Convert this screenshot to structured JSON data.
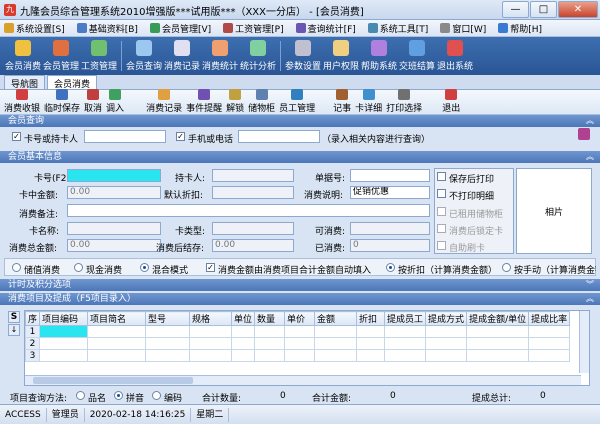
{
  "window": {
    "title": "九隆会员综合管理系统2010增强版***试用版***（XXX一分店） - [会员消费]",
    "min": "—",
    "max": "□",
    "close": "✕"
  },
  "menu": [
    {
      "label": "系统设置[S]",
      "color": "#d9a02b"
    },
    {
      "label": "基础资料[B]",
      "color": "#4b7bc4"
    },
    {
      "label": "会员管理[V]",
      "color": "#3a9a5a"
    },
    {
      "label": "工资管理[P]",
      "color": "#b04a4a"
    },
    {
      "label": "查询统计[F]",
      "color": "#6a58b0"
    },
    {
      "label": "系统工具[T]",
      "color": "#4a8ab0"
    },
    {
      "label": "窗口[W]",
      "color": "#8a8a8a"
    },
    {
      "label": "帮助[H]",
      "color": "#3a7ad0"
    }
  ],
  "toolbar": [
    {
      "label": "会员消费",
      "color": "#f0c040"
    },
    {
      "label": "会员管理",
      "color": "#e07040"
    },
    {
      "label": "工资管理",
      "color": "#70c070"
    },
    {
      "label": "会员查询",
      "color": "#9cc8f0"
    },
    {
      "label": "消费记录",
      "color": "#e0e0f0"
    },
    {
      "label": "消费统计",
      "color": "#f0a070"
    },
    {
      "label": "统计分析",
      "color": "#80d0a0"
    },
    {
      "label": "参数设置",
      "color": "#c0c0d0"
    },
    {
      "label": "用户权限",
      "color": "#f0d080"
    },
    {
      "label": "帮助系统",
      "color": "#b080e0"
    },
    {
      "label": "交班结算",
      "color": "#60a0e0"
    },
    {
      "label": "退出系统",
      "color": "#e05050"
    }
  ],
  "tabs": [
    "导航图",
    "会员消费"
  ],
  "subtoolbar": [
    {
      "label": "消费收银",
      "color": "#d04040"
    },
    {
      "label": "临时保存",
      "color": "#4070c0"
    },
    {
      "label": "取消",
      "color": "#c04040"
    },
    {
      "label": "调入",
      "color": "#40a060"
    },
    {
      "label": "消费记录",
      "color": "#e0a040"
    },
    {
      "label": "事件提醒",
      "color": "#7050b0"
    },
    {
      "label": "解锁",
      "color": "#c0a040"
    },
    {
      "label": "储物柜",
      "color": "#6080b0"
    },
    {
      "label": "员工管理",
      "color": "#3080c0"
    },
    {
      "label": "记事",
      "color": "#a06030"
    },
    {
      "label": "卡详细",
      "color": "#4090d0"
    },
    {
      "label": "打印选择",
      "color": "#707070"
    },
    {
      "label": "退出",
      "color": "#d04040"
    }
  ],
  "query": {
    "header": "会员查询",
    "cb_card": "卡号或持卡人",
    "cb_phone": "手机或电话",
    "hint": "（录入相关内容进行查询）"
  },
  "basic": {
    "header": "会员基本信息",
    "card_no_label": "卡号(F2):",
    "holder_label": "持卡人:",
    "bill_label": "单据号:",
    "balance_label": "卡中金额:",
    "balance_value": "0.00",
    "discount_label": "默认折扣:",
    "desc_label": "消费说明:",
    "desc_value": "促销优惠",
    "remark_label": "消费备注:",
    "cardname_label": "卡名称:",
    "cardtype_label": "卡类型:",
    "times_label": "可消费:",
    "total_label": "消费总金额:",
    "total_value": "0.00",
    "after_label": "消费后结存:",
    "after_value": "0.00",
    "used_label": "已消费:",
    "used_value": "0",
    "opts": [
      "保存后打印",
      "不打印明细",
      "已租用储物柜",
      "消费后锁定卡",
      "自助刷卡"
    ],
    "photo_label": "相片"
  },
  "mode": {
    "opt1": "储值消费",
    "opt2": "现金消费",
    "opt3": "混合模式",
    "auto": "消费金额由消费项目合计金额自动填入",
    "disc1": "按折扣（计算消费金额）",
    "disc2": "按手动（计算消费金额）"
  },
  "section_points": "计时及积分选项",
  "section_items": "消费项目及提成（F5项目录入）",
  "grid": {
    "side_s": "S",
    "columns": [
      "序",
      "项目编码",
      "项目简名",
      "型号",
      "规格",
      "单位",
      "数量",
      "单价",
      "金额",
      "折扣",
      "提成员工",
      "提成方式",
      "提成金额/单位",
      "提成比率"
    ],
    "rows": [
      "1",
      "2",
      "3"
    ]
  },
  "footer": {
    "method_label": "项目查询方法:",
    "m1": "品名",
    "m2": "拼音",
    "m3": "编码",
    "qty_label": "合计数量:",
    "qty_value": "0",
    "amt_label": "合计金额:",
    "amt_value": "0",
    "comm_label": "提成总计:",
    "comm_value": "0"
  },
  "status": [
    "ACCESS",
    "管理员",
    "2020-02-18 14:16:25",
    "星期二"
  ]
}
